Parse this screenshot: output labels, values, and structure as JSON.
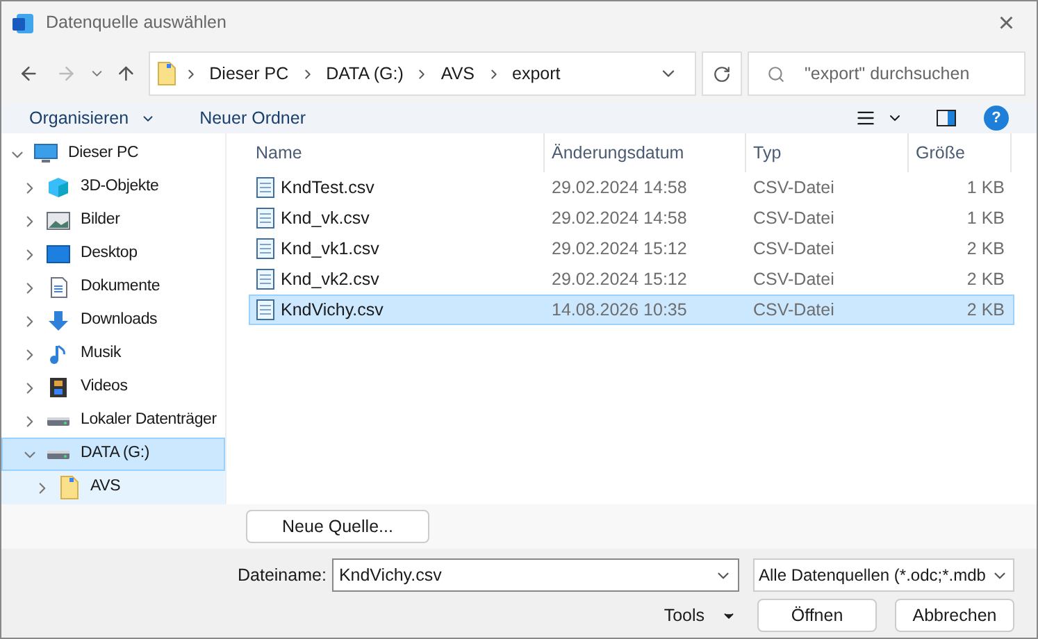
{
  "window": {
    "title": "Datenquelle auswählen",
    "close": "×"
  },
  "address": {
    "crumbs": [
      "Dieser PC",
      "DATA (G:)",
      "AVS",
      "export"
    ]
  },
  "search": {
    "placeholder": "\"export\" durchsuchen"
  },
  "toolbar": {
    "organize": "Organisieren",
    "new_folder": "Neuer Ordner",
    "help": "?"
  },
  "sidebar": {
    "items": [
      {
        "label": "Dieser PC",
        "kind": "pc",
        "expanded": true,
        "selected": false,
        "children": [
          {
            "label": "3D-Objekte",
            "kind": "cube",
            "expanded": false,
            "selected": false
          },
          {
            "label": "Bilder",
            "kind": "pictures",
            "expanded": false,
            "selected": false
          },
          {
            "label": "Desktop",
            "kind": "desktop",
            "expanded": false,
            "selected": false
          },
          {
            "label": "Dokumente",
            "kind": "documents",
            "expanded": false,
            "selected": false
          },
          {
            "label": "Downloads",
            "kind": "downloads",
            "expanded": false,
            "selected": false
          },
          {
            "label": "Musik",
            "kind": "music",
            "expanded": false,
            "selected": false
          },
          {
            "label": "Videos",
            "kind": "videos",
            "expanded": false,
            "selected": false
          },
          {
            "label": "Lokaler Datenträger",
            "kind": "drive",
            "expanded": false,
            "selected": false
          },
          {
            "label": "DATA (G:)",
            "kind": "drive",
            "expanded": true,
            "selected": true,
            "children": [
              {
                "label": "AVS",
                "kind": "folder",
                "expanded": false,
                "selected": false,
                "hovered": true
              }
            ]
          }
        ]
      }
    ]
  },
  "table": {
    "columns": [
      "Name",
      "Änderungsdatum",
      "Typ",
      "Größe"
    ],
    "rows": [
      {
        "name": "KndTest.csv",
        "date": "29.02.2024 14:58",
        "type": "CSV-Datei",
        "size": "1 KB",
        "selected": false
      },
      {
        "name": "Knd_vk.csv",
        "date": "29.02.2024 14:58",
        "type": "CSV-Datei",
        "size": "1 KB",
        "selected": false
      },
      {
        "name": "Knd_vk1.csv",
        "date": "29.02.2024 15:12",
        "type": "CSV-Datei",
        "size": "2 KB",
        "selected": false
      },
      {
        "name": "Knd_vk2.csv",
        "date": "29.02.2024 15:12",
        "type": "CSV-Datei",
        "size": "2 KB",
        "selected": false
      },
      {
        "name": "KndVichy.csv",
        "date": "14.08.2026 10:35",
        "type": "CSV-Datei",
        "size": "2 KB",
        "selected": true
      }
    ]
  },
  "new_source_button": "Neue Quelle...",
  "filename": {
    "label": "Dateiname:",
    "value": "KndVichy.csv"
  },
  "filter": {
    "value": "Alle Datenquellen (*.odc;*.mdb"
  },
  "tools": "Tools",
  "buttons": [
    "Öffnen",
    "Abbrechen"
  ]
}
